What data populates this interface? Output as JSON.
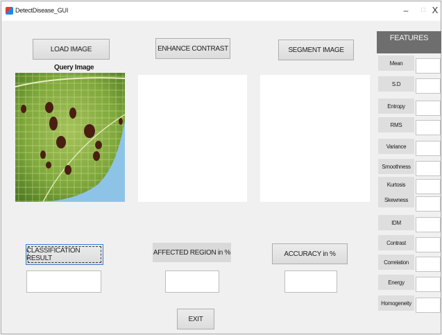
{
  "window": {
    "title": "DetectDisease_GUI",
    "minimize": "–",
    "maximize": "□",
    "close": "X"
  },
  "buttons": {
    "load_image": "LOAD IMAGE",
    "enhance_contrast": "ENHANCE CONTRAST",
    "segment_image": "SEGMENT IMAGE",
    "classification_result": "CLASSIFICATION RESULT",
    "affected_region": "AFFECTED REGION in %",
    "accuracy": "ACCURACY in %",
    "exit": "EXIT"
  },
  "query_image_label": "Query Image",
  "features": {
    "header": "FEATURES",
    "items": [
      "Mean",
      "S.D",
      "Entropy",
      "RMS",
      "Variance",
      "Smoothness",
      "Kurtosis",
      "Skewness",
      "IDM",
      "Contrast",
      "Correlation",
      "Energy",
      "Homogeneity"
    ]
  },
  "colors": {
    "window_bg": "#f0f0f0",
    "features_header_bg": "#6e6e6e",
    "leaf_green": "#7fa83c",
    "background_blue": "#8ec3e8"
  }
}
